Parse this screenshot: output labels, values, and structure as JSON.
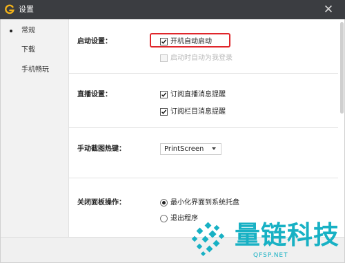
{
  "window": {
    "title": "设置",
    "close_glyph": "✕"
  },
  "sidebar": {
    "items": [
      {
        "label": "常规",
        "selected": true
      },
      {
        "label": "下载",
        "selected": false
      },
      {
        "label": "手机畅玩",
        "selected": false
      }
    ]
  },
  "startup": {
    "label": "启动设置：",
    "auto_start": {
      "label": "开机自动启动",
      "checked": true
    },
    "auto_login": {
      "label": "启动时自动为我登录",
      "checked": false,
      "disabled": true
    }
  },
  "live": {
    "label": "直播设置：",
    "live_notify": {
      "label": "订阅直播消息提醒",
      "checked": true
    },
    "column_notify": {
      "label": "订阅栏目消息提醒",
      "checked": true
    }
  },
  "screenshot": {
    "label": "手动截图热键：",
    "hotkey": "PrintScreen"
  },
  "close_panel": {
    "label": "关闭面板操作：",
    "options": [
      {
        "label": "最小化界面到系统托盘",
        "selected": true
      },
      {
        "label": "退出程序",
        "selected": false
      }
    ]
  },
  "watermark": {
    "brand": "量链科技",
    "url": "QFSP.NET"
  },
  "colors": {
    "titlebar": "#3b3d41",
    "highlight": "#e0262b",
    "watermark": "#18b1c4",
    "app_icon": "#f2b21a"
  }
}
